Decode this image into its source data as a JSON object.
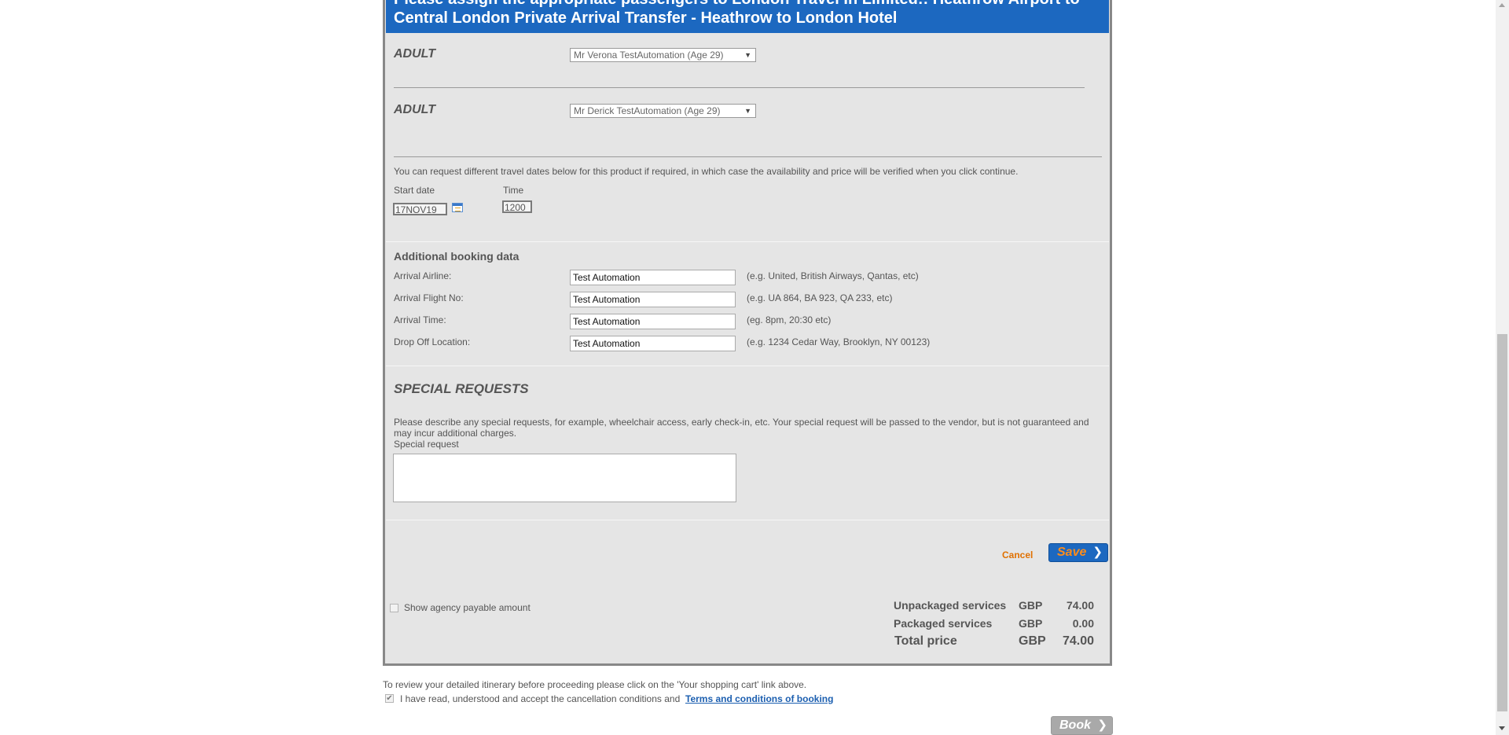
{
  "header": {
    "title": "Please assign the appropriate passengers to London Travel In Limited:: Heathrow Airport to Central London Private Arrival Transfer - Heathrow to London Hotel"
  },
  "passengers": [
    {
      "type": "ADULT",
      "selected": "Mr Verona TestAutomation (Age 29)"
    },
    {
      "type": "ADULT",
      "selected": "Mr Derick TestAutomation (Age 29)"
    }
  ],
  "dates": {
    "info": "You can request different travel dates below for this product if required, in which case the availability and price will be verified when you click continue.",
    "start_label": "Start date",
    "start_value": "17NOV19",
    "time_label": "Time",
    "time_value": "1200"
  },
  "booking_data": {
    "title": "Additional booking data",
    "fields": [
      {
        "label": "Arrival Airline:",
        "value": "Test Automation",
        "hint": "(e.g. United, British Airways, Qantas, etc)"
      },
      {
        "label": "Arrival Flight No:",
        "value": "Test Automation",
        "hint": "(e.g. UA 864, BA 923, QA 233, etc)"
      },
      {
        "label": "Arrival Time:",
        "value": "Test Automation",
        "hint": "(eg. 8pm, 20:30 etc)"
      },
      {
        "label": "Drop Off Location:",
        "value": "Test Automation",
        "hint": "(e.g. 1234 Cedar Way, Brooklyn, NY 00123)"
      }
    ]
  },
  "special": {
    "title": "SPECIAL REQUESTS",
    "description": "Please describe any special requests, for example, wheelchair access, early check-in, etc. Your special request will be passed to the vendor, but is not guaranteed and may incur additional charges.",
    "field_label": "Special request",
    "value": ""
  },
  "actions": {
    "cancel_label": "Cancel",
    "save_label": "Save",
    "book_label": "Book"
  },
  "agency": {
    "label": "Show agency payable amount",
    "checked": false
  },
  "pricing": {
    "rows": [
      {
        "label": "Unpackaged services",
        "currency": "GBP",
        "amount": "74.00"
      },
      {
        "label": "Packaged services",
        "currency": "GBP",
        "amount": "0.00"
      }
    ],
    "total": {
      "label": "Total price",
      "currency": "GBP",
      "amount": "74.00"
    }
  },
  "footer": {
    "review_text": "To review your detailed itinerary before proceeding please click on the 'Your shopping cart' link above.",
    "accept_text": "I have read, understood and accept the cancellation conditions and",
    "terms_link": "Terms and conditions of booking",
    "accept_checked": true
  },
  "icons": {
    "calendar": "calendar-icon",
    "dropdown": "chevron-down-icon",
    "arrow": "chevron-right-icon"
  },
  "colors": {
    "header_bg": "#1c68c0",
    "panel_bg": "#e5e5e5",
    "cancel": "#e07000",
    "save_text": "#ff8c1a",
    "link": "#1c5fb0"
  }
}
